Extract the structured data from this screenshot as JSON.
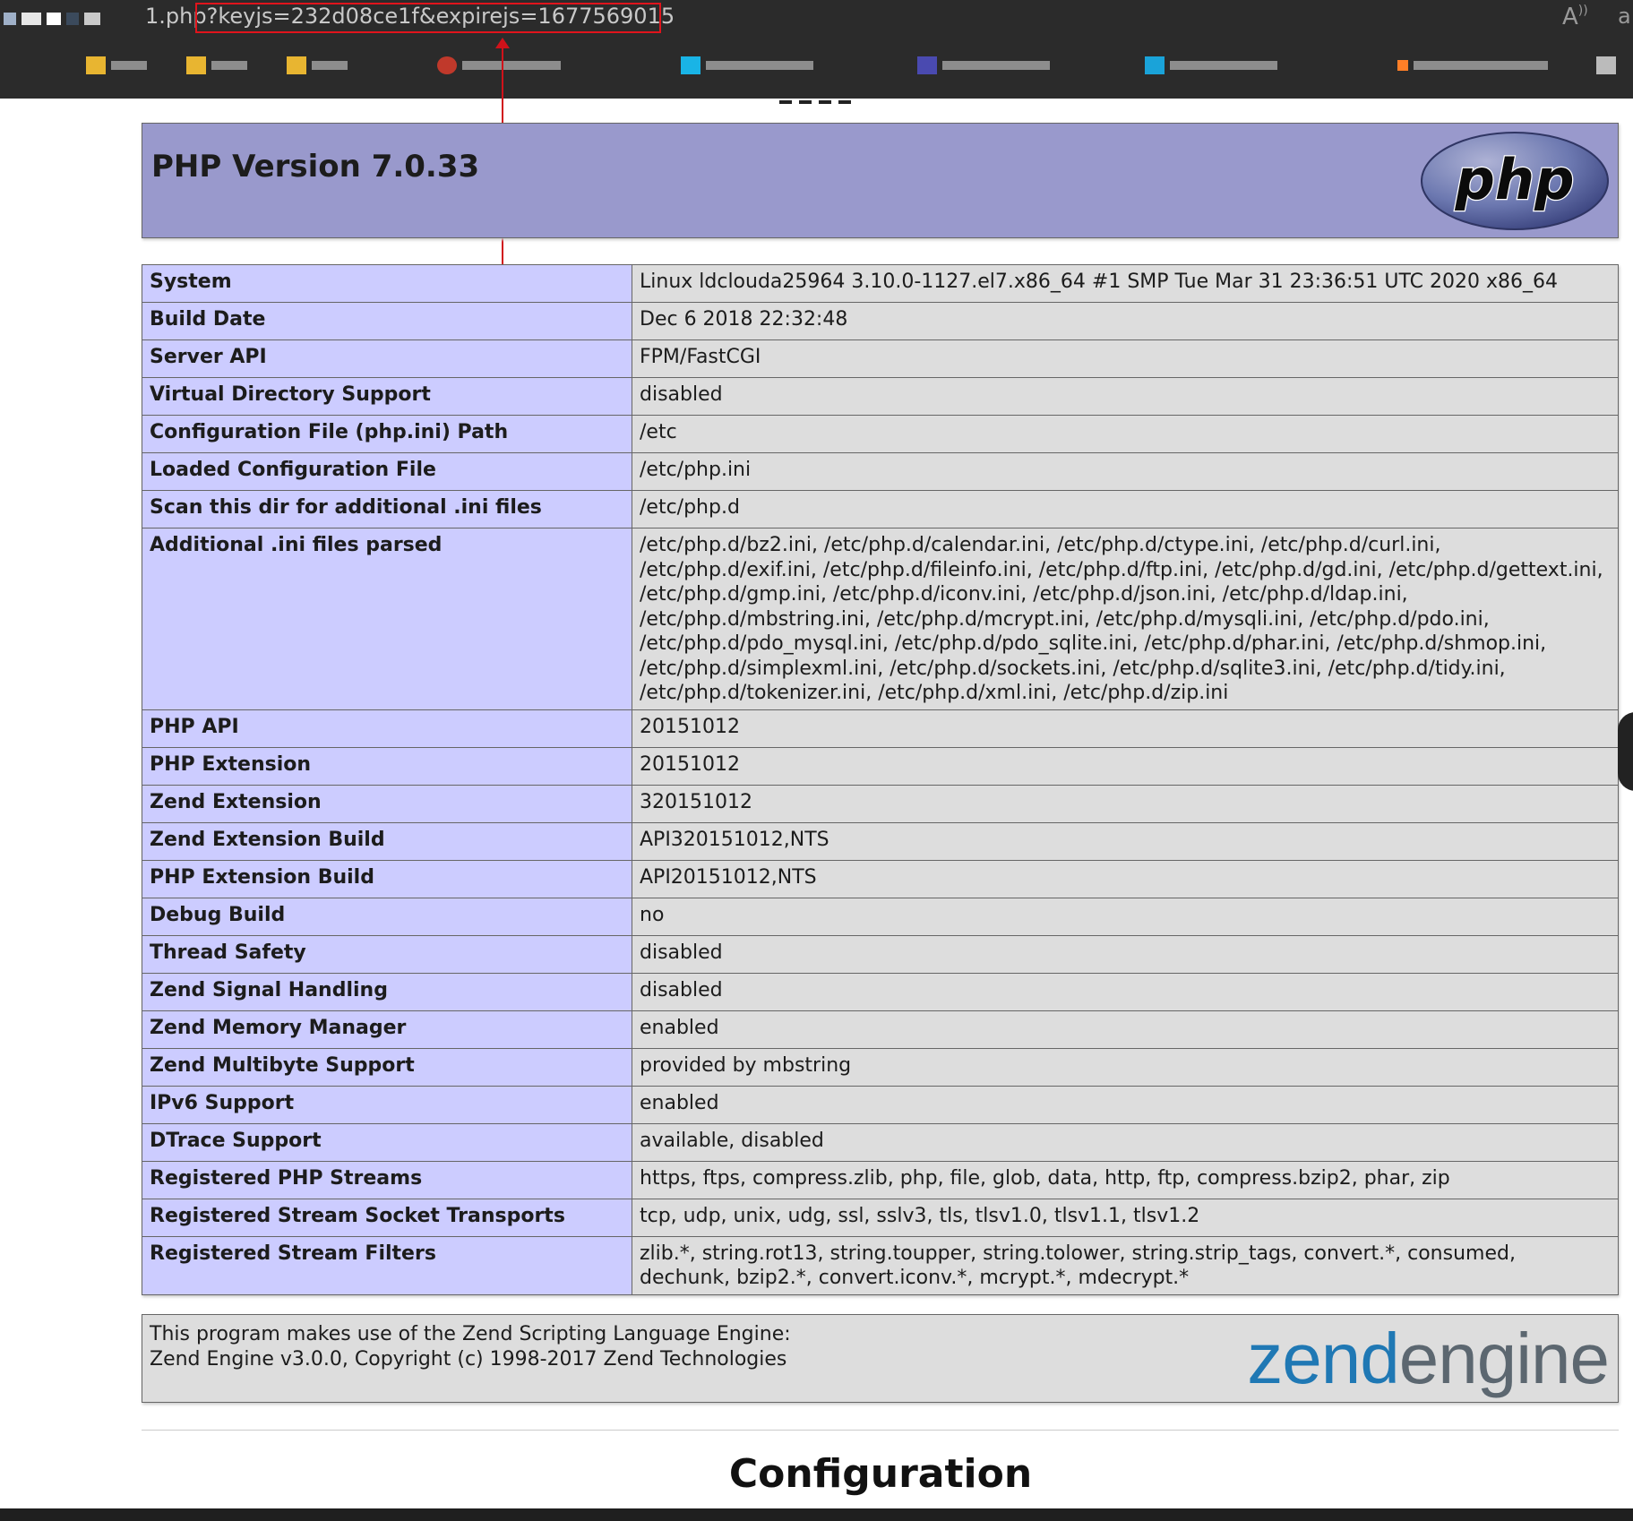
{
  "browser": {
    "url_prefix": "1.php",
    "url_query": "?keyjs=232d08ce1f&expirejs=1677569015",
    "read_aloud_icon": "A",
    "profile_letter": "a"
  },
  "header": {
    "title": "PHP Version 7.0.33",
    "logo_text": "php"
  },
  "info_rows": [
    {
      "key": "System",
      "value": "Linux ldclouda25964 3.10.0-1127.el7.x86_64 #1 SMP Tue Mar 31 23:36:51 UTC 2020 x86_64"
    },
    {
      "key": "Build Date",
      "value": "Dec 6 2018 22:32:48"
    },
    {
      "key": "Server API",
      "value": "FPM/FastCGI"
    },
    {
      "key": "Virtual Directory Support",
      "value": "disabled"
    },
    {
      "key": "Configuration File (php.ini) Path",
      "value": "/etc"
    },
    {
      "key": "Loaded Configuration File",
      "value": "/etc/php.ini"
    },
    {
      "key": "Scan this dir for additional .ini files",
      "value": "/etc/php.d"
    },
    {
      "key": "Additional .ini files parsed",
      "value": "/etc/php.d/bz2.ini, /etc/php.d/calendar.ini, /etc/php.d/ctype.ini, /etc/php.d/curl.ini, /etc/php.d/exif.ini, /etc/php.d/fileinfo.ini, /etc/php.d/ftp.ini, /etc/php.d/gd.ini, /etc/php.d/gettext.ini, /etc/php.d/gmp.ini, /etc/php.d/iconv.ini, /etc/php.d/json.ini, /etc/php.d/ldap.ini, /etc/php.d/mbstring.ini, /etc/php.d/mcrypt.ini, /etc/php.d/mysqli.ini, /etc/php.d/pdo.ini, /etc/php.d/pdo_mysql.ini, /etc/php.d/pdo_sqlite.ini, /etc/php.d/phar.ini, /etc/php.d/shmop.ini, /etc/php.d/simplexml.ini, /etc/php.d/sockets.ini, /etc/php.d/sqlite3.ini, /etc/php.d/tidy.ini, /etc/php.d/tokenizer.ini, /etc/php.d/xml.ini, /etc/php.d/zip.ini"
    },
    {
      "key": "PHP API",
      "value": "20151012"
    },
    {
      "key": "PHP Extension",
      "value": "20151012"
    },
    {
      "key": "Zend Extension",
      "value": "320151012"
    },
    {
      "key": "Zend Extension Build",
      "value": "API320151012,NTS"
    },
    {
      "key": "PHP Extension Build",
      "value": "API20151012,NTS"
    },
    {
      "key": "Debug Build",
      "value": "no"
    },
    {
      "key": "Thread Safety",
      "value": "disabled"
    },
    {
      "key": "Zend Signal Handling",
      "value": "disabled"
    },
    {
      "key": "Zend Memory Manager",
      "value": "enabled"
    },
    {
      "key": "Zend Multibyte Support",
      "value": "provided by mbstring"
    },
    {
      "key": "IPv6 Support",
      "value": "enabled"
    },
    {
      "key": "DTrace Support",
      "value": "available, disabled"
    },
    {
      "key": "Registered PHP Streams",
      "value": "https, ftps, compress.zlib, php, file, glob, data, http, ftp, compress.bzip2, phar, zip"
    },
    {
      "key": "Registered Stream Socket Transports",
      "value": "tcp, udp, unix, udg, ssl, sslv3, tls, tlsv1.0, tlsv1.1, tlsv1.2"
    },
    {
      "key": "Registered Stream Filters",
      "value": "zlib.*, string.rot13, string.toupper, string.tolower, string.strip_tags, convert.*, consumed, dechunk, bzip2.*, convert.iconv.*, mcrypt.*, mdecrypt.*"
    }
  ],
  "zend": {
    "line1": "This program makes use of the Zend Scripting Language Engine:",
    "line2": "Zend Engine v3.0.0, Copyright (c) 1998-2017 Zend Technologies",
    "logo_part1": "zend",
    "logo_part2": "engine"
  },
  "section_heading": "Configuration",
  "colors": {
    "header_bg": "#9999cc",
    "key_bg": "#ccccff",
    "value_bg": "#dddddd",
    "highlight": "#e0141c"
  }
}
